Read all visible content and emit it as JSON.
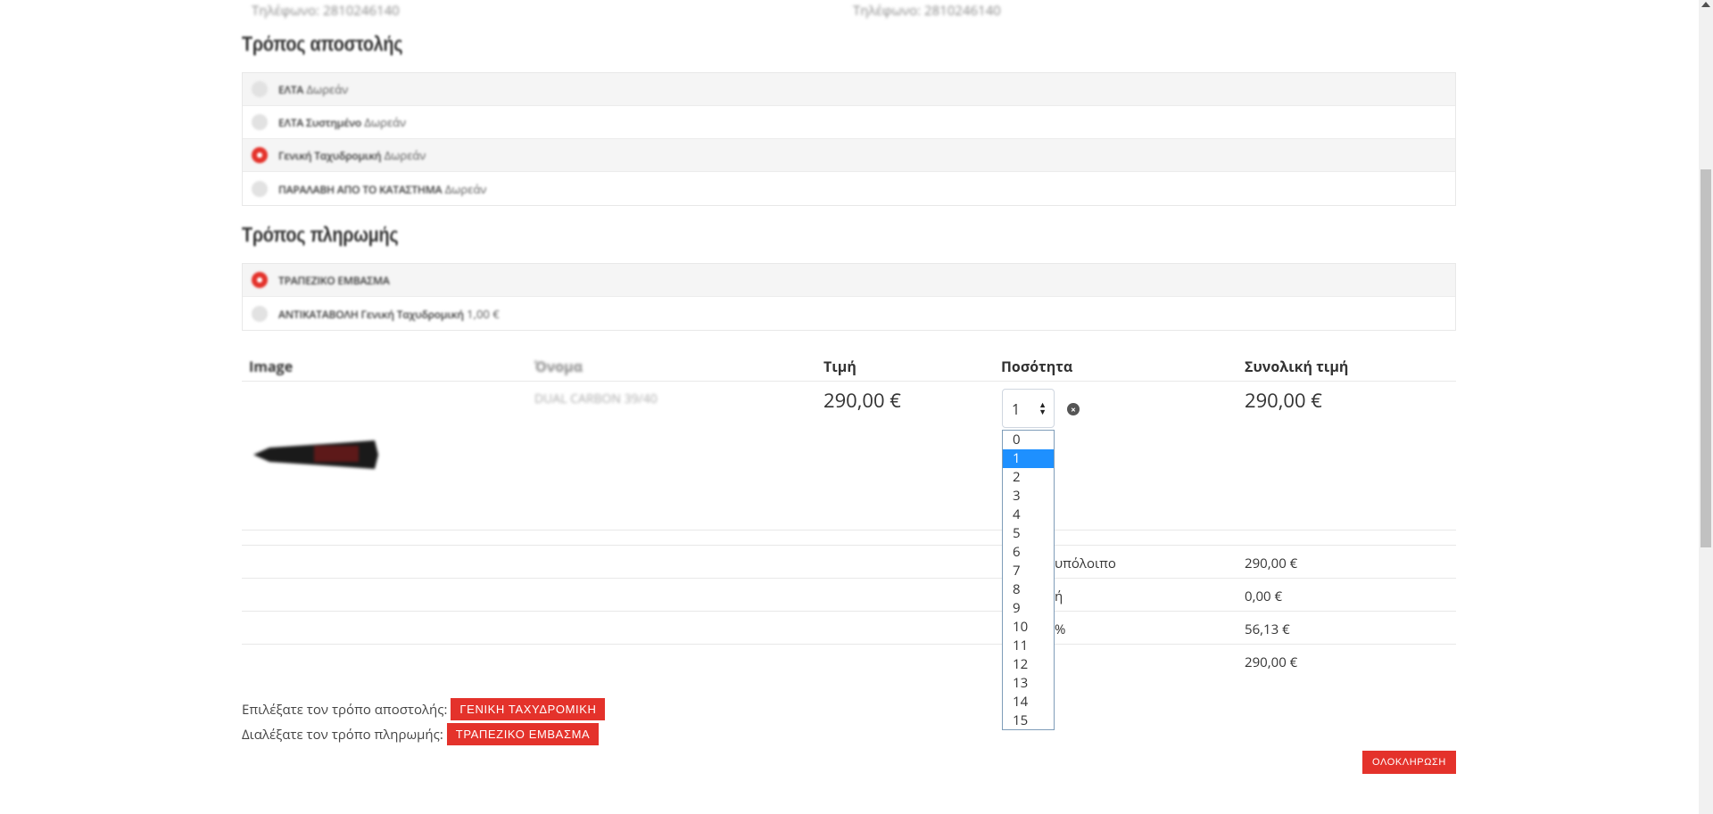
{
  "addresses": {
    "billing_phone": "Τηλέφωνο: 2810246140",
    "shipping_phone": "Τηλέφωνο: 2810246140"
  },
  "shipping": {
    "title": "Τρόπος αποστολής",
    "options": [
      {
        "name": "ΕΛΤΑ",
        "price": "Δωρεάν",
        "selected": false
      },
      {
        "name": "ΕΛΤΑ Συστημένο",
        "price": "Δωρεάν",
        "selected": false
      },
      {
        "name": "Γενική Ταχυδρομική",
        "price": "Δωρεάν",
        "selected": true
      },
      {
        "name": "ΠΑΡΑΛΑΒΗ ΑΠΟ ΤΟ ΚΑΤΑΣΤΗΜΑ",
        "price": "Δωρεάν",
        "selected": false
      }
    ]
  },
  "payment": {
    "title": "Τρόπος πληρωμής",
    "options": [
      {
        "name": "ΤΡΑΠΕΖΙΚΟ ΕΜΒΑΣΜΑ",
        "price": "",
        "selected": true
      },
      {
        "name": "ΑΝΤΙΚΑΤΑΒΟΛΗ Γενική Ταχυδρομική",
        "price": "1,00 €",
        "selected": false
      }
    ]
  },
  "cart": {
    "headers": {
      "image": "Image",
      "name": "Όνομα",
      "price": "Τιμή",
      "quantity": "Ποσότητα",
      "total": "Συνολική τιμή"
    },
    "item": {
      "name": "DUAL CARBON 39/40",
      "price": "290,00 €",
      "quantity": "1",
      "total": "290,00 €"
    },
    "quantity_options": [
      "0",
      "1",
      "2",
      "3",
      "4",
      "5",
      "6",
      "7",
      "8",
      "9",
      "10",
      "11",
      "12",
      "13",
      "14",
      "15"
    ],
    "quantity_selected": "1",
    "totals": [
      {
        "label": "υπόλοιπο",
        "value": "290,00 €"
      },
      {
        "label": "ή",
        "value": "0,00 €"
      },
      {
        "label": "%",
        "value": "56,13 €"
      },
      {
        "label": "",
        "value": "290,00 €"
      }
    ]
  },
  "summary": {
    "shipping_prompt": "Επιλέξατε τον τρόπο αποστολής:",
    "shipping_choice": "ΓΕΝΙΚΗ ΤΑΧΥΔΡΟΜΙΚΗ",
    "payment_prompt": "Διαλέξατε τον τρόπο πληρωμής:",
    "payment_choice": "ΤΡΑΠΕΖΙΚΟ ΕΜΒΑΣΜΑ",
    "finish_label": "ΟΛΟΚΛΗΡΩΣΗ"
  },
  "colors": {
    "accent": "#e4322b",
    "dropdown_highlight": "#1e90ff"
  }
}
